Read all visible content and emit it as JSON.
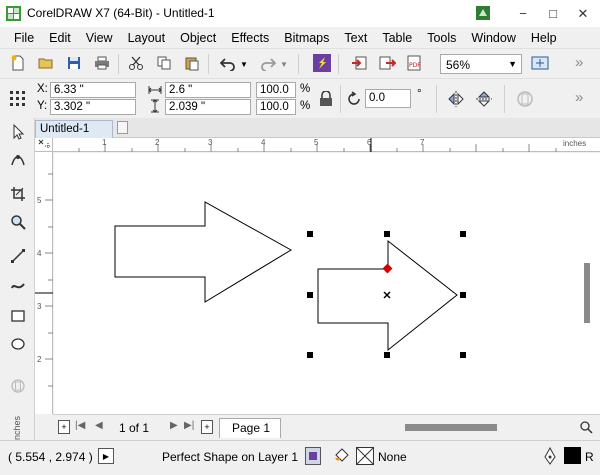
{
  "window": {
    "title": "CorelDRAW X7 (64-Bit) - Untitled-1",
    "minimize_glyph": "−",
    "maximize_glyph": "□",
    "close_glyph": "✕"
  },
  "menu": [
    "File",
    "Edit",
    "View",
    "Layout",
    "Object",
    "Effects",
    "Bitmaps",
    "Text",
    "Table",
    "Tools",
    "Window",
    "Help"
  ],
  "standard_toolbar": {
    "zoom_level": "56%"
  },
  "property_bar": {
    "x_label": "X:",
    "x_value": "6.33 \"",
    "y_label": "Y:",
    "y_value": "3.302 \"",
    "width_value": "2.6 \"",
    "height_value": "2.039 \"",
    "scale_w": "100.0",
    "scale_h": "100.0",
    "percent": "%",
    "rotation": "0.0",
    "degree": "°"
  },
  "document_tab": {
    "label": "Untitled-1"
  },
  "ruler": {
    "h_ticks": [
      "1",
      "2",
      "3",
      "4",
      "5",
      "6",
      "7"
    ],
    "h_unit": "inches",
    "v_ticks": [
      "5",
      "4",
      "3",
      "2"
    ],
    "v_unit": "inches"
  },
  "page_nav": {
    "page_count": "1 of 1",
    "page_tab": "Page 1"
  },
  "status": {
    "coordinates": "( 5.554 , 2.974 )",
    "object_info": "Perfect Shape on Layer 1",
    "fill_label": "None",
    "outline_label": "R"
  },
  "colors": {
    "accent": "#6b3fa0",
    "handle": "#000000",
    "node_red": "#d40000",
    "tab_bg": "#dfe8f5"
  }
}
